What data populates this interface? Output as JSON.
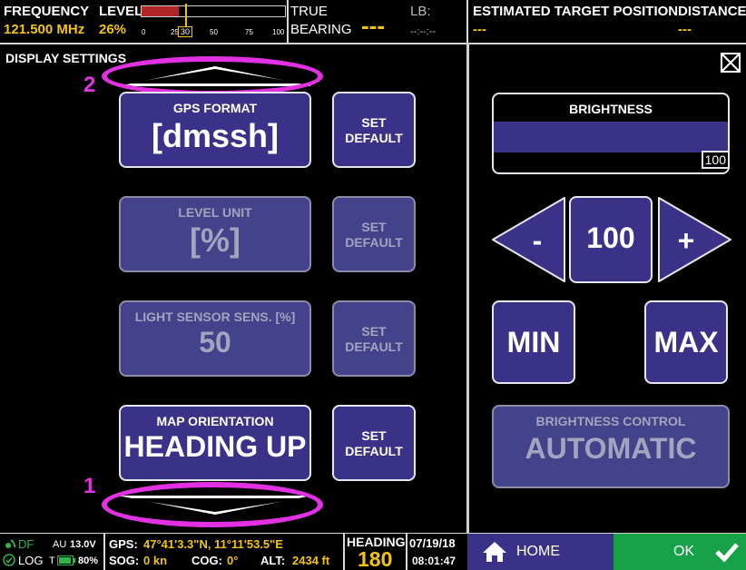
{
  "topbar": {
    "frequency_label": "FREQUENCY",
    "frequency_value": "121.500 MHz",
    "level_label": "LEVEL",
    "level_value": "26%",
    "level_fraction": 0.26,
    "level_ticks": [
      "0",
      "25",
      "30",
      "50",
      "75",
      "100"
    ],
    "true_bearing_label_1": "TRUE",
    "true_bearing_label_2": "BEARING",
    "true_bearing_value": "---",
    "lb_label": "LB:",
    "lb_value": "--:--:--",
    "est_target_label": "ESTIMATED TARGET POSITION",
    "est_target_value": "---",
    "distance_label": "DISTANCE",
    "distance_value": "---"
  },
  "left_panel": {
    "title": "DISPLAY SETTINGS",
    "settings": [
      {
        "caption": "GPS FORMAT",
        "value": "[dmssh]",
        "enabled": true
      },
      {
        "caption": "LEVEL UNIT",
        "value": "[%]",
        "enabled": false
      },
      {
        "caption": "LIGHT SENSOR SENS. [%]",
        "value": "50",
        "enabled": false
      },
      {
        "caption": "MAP ORIENTATION",
        "value": "HEADING UP",
        "enabled": true
      }
    ],
    "set_default_line1": "SET",
    "set_default_line2": "DEFAULT"
  },
  "annotations": {
    "top_number": "2",
    "bottom_number": "1"
  },
  "right_panel": {
    "brightness_title": "BRIGHTNESS",
    "brightness_value": "100",
    "brightness_fraction": 1.0,
    "decrement_label": "-",
    "current_value": "100",
    "increment_label": "+",
    "min_label": "MIN",
    "max_label": "MAX",
    "brightness_control_caption": "BRIGHTNESS CONTROL",
    "brightness_control_value": "AUTOMATIC",
    "close_icon": "close-x-icon"
  },
  "bottombar": {
    "df_label": "DF",
    "au_label": "AU",
    "au_value": "13.0V",
    "log_label": "LOG",
    "t_label": "T",
    "battery_value": "80%",
    "gps_label": "GPS:",
    "gps_value": "47°41'3.3\"N, 11°11'53.5\"E",
    "sog_label": "SOG:",
    "sog_value": "0 kn",
    "cog_label": "COG:",
    "cog_value": "0°",
    "alt_label": "ALT:",
    "alt_value": "2434 ft",
    "heading_label": "HEADING",
    "heading_value": "180",
    "date": "07/19/18",
    "time": "08:01:47",
    "home_label": "HOME",
    "ok_label": "OK"
  },
  "colors": {
    "accent_purple": "#3a3289",
    "level_red": "#b02525",
    "value_yellow": "#f2c40f",
    "ok_green": "#17a24a",
    "annotation_magenta": "#e231e2"
  }
}
